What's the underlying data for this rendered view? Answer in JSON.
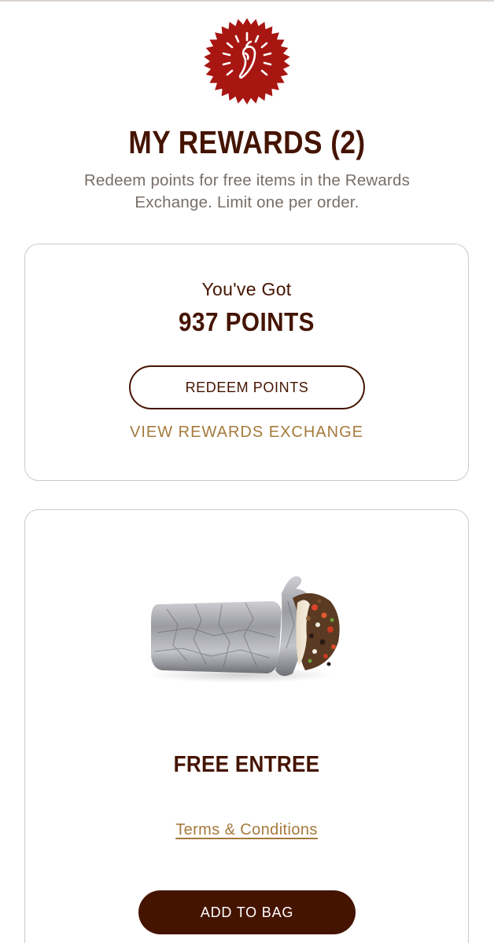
{
  "header": {
    "title": "MY REWARDS (2)",
    "subtitle": "Redeem points for free items in the Rewards Exchange. Limit one per order.",
    "badge_icon": "chili-pepper-badge-icon"
  },
  "points_card": {
    "label": "You've Got",
    "points": "937 POINTS",
    "redeem_label": "REDEEM POINTS",
    "exchange_link": "VIEW REWARDS EXCHANGE"
  },
  "reward_card": {
    "image_icon": "burrito-image",
    "name": "FREE ENTREE",
    "terms_link": "Terms & Conditions",
    "add_label": "ADD TO BAG"
  },
  "colors": {
    "brand_brown": "#451400",
    "badge_red": "#a81612",
    "link_gold": "#a57a3c",
    "subtitle_gray": "#786e68",
    "card_border": "#cfc9c4"
  }
}
